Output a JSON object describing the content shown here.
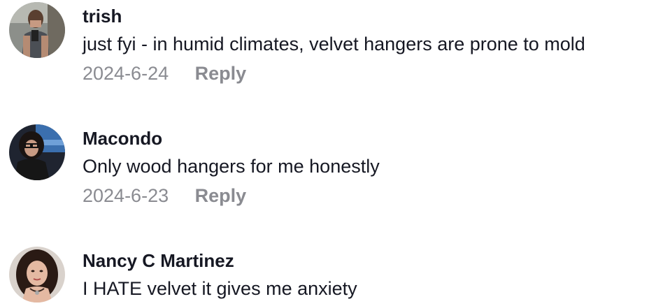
{
  "comments": [
    {
      "username": "trish",
      "text": "just fyi - in humid climates, velvet hangers are prone to mold",
      "date": "2024-6-24",
      "reply_label": "Reply"
    },
    {
      "username": "Macondo",
      "text": "Only wood hangers for me honestly",
      "date": "2024-6-23",
      "reply_label": "Reply"
    },
    {
      "username": "Nancy C Martinez",
      "text": "I HATE velvet it gives me anxiety"
    }
  ]
}
